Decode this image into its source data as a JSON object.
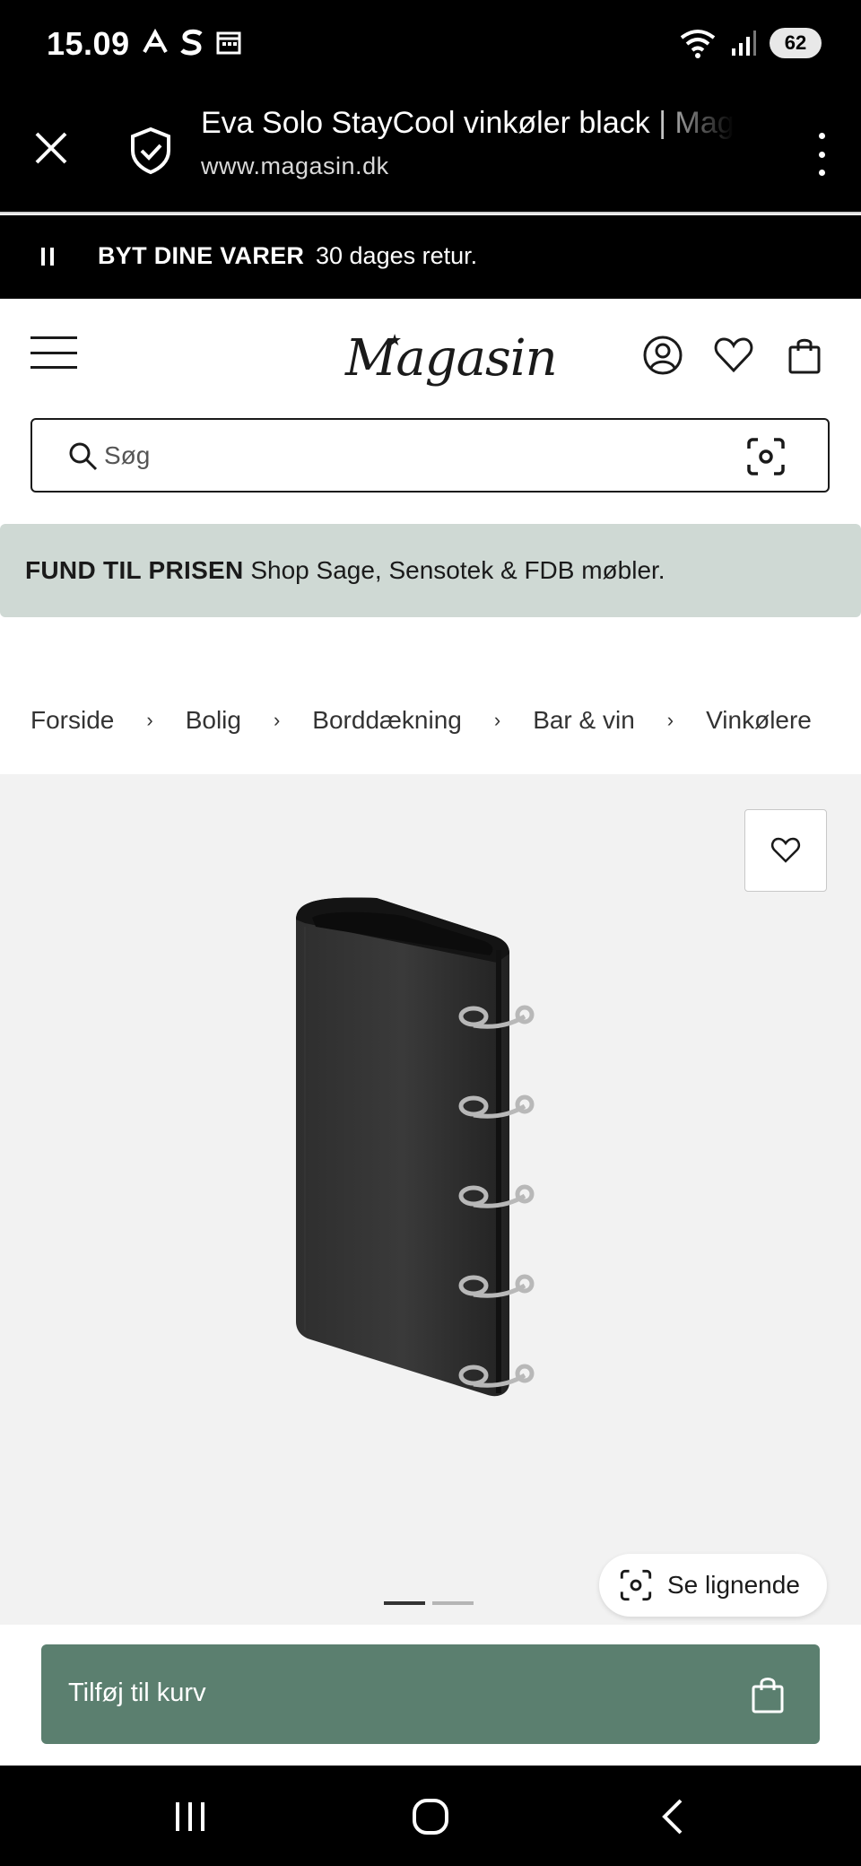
{
  "status_bar": {
    "time": "15.09",
    "battery": "62"
  },
  "browser": {
    "title": "Eva Solo StayCool vinkøler black | Magasin",
    "url": "www.magasin.dk"
  },
  "promo": {
    "strong": "BYT DINE VARER",
    "text": "30 dages retur."
  },
  "header": {
    "logo": "Magasin"
  },
  "search": {
    "placeholder": "Søg"
  },
  "sage_banner": {
    "strong": "FUND TIL PRISEN",
    "text": " Shop Sage, Sensotek & FDB møbler."
  },
  "breadcrumb": [
    "Forside",
    "Bolig",
    "Borddækning",
    "Bar & vin",
    "Vinkølere"
  ],
  "gallery": {
    "similar_label": "Se lignende",
    "active_image": 1,
    "image_count": 2
  },
  "cart": {
    "add_label": "Tilføj til kurv"
  },
  "colors": {
    "accent_green": "#5b7f6f",
    "banner_sage": "#cfd9d4"
  }
}
